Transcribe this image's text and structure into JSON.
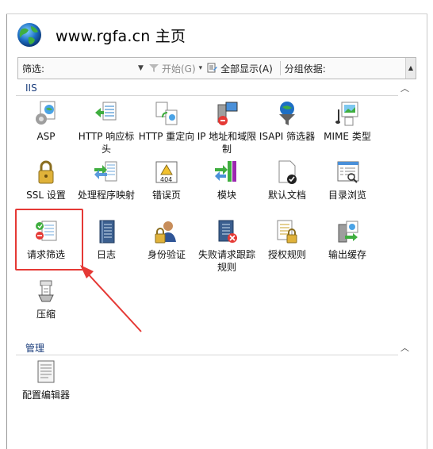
{
  "header": {
    "title": "www.rgfa.cn 主页",
    "icon": "globe-icon"
  },
  "toolbar": {
    "filter_label": "筛选:",
    "go_label": "开始(G)",
    "show_all_label": "全部显示(A)",
    "group_by_label": "分组依据:"
  },
  "sections": {
    "iis": {
      "label": "IIS"
    },
    "management": {
      "label": "管理"
    }
  },
  "features": [
    {
      "label": "ASP",
      "icon": "asp-icon"
    },
    {
      "label": "HTTP 响应标头",
      "icon": "http-response-headers-icon"
    },
    {
      "label": "HTTP 重定向",
      "icon": "http-redirect-icon"
    },
    {
      "label": "IP 地址和域限制",
      "icon": "ip-domain-restrictions-icon"
    },
    {
      "label": "ISAPI 筛选器",
      "icon": "isapi-filters-icon"
    },
    {
      "label": "MIME 类型",
      "icon": "mime-types-icon"
    },
    {
      "label": "SSL 设置",
      "icon": "ssl-settings-icon"
    },
    {
      "label": "处理程序映射",
      "icon": "handler-mappings-icon"
    },
    {
      "label": "错误页",
      "icon": "error-pages-icon"
    },
    {
      "label": "模块",
      "icon": "modules-icon"
    },
    {
      "label": "默认文档",
      "icon": "default-document-icon"
    },
    {
      "label": "目录浏览",
      "icon": "directory-browsing-icon"
    },
    {
      "label": "请求筛选",
      "icon": "request-filtering-icon"
    },
    {
      "label": "日志",
      "icon": "logging-icon"
    },
    {
      "label": "身份验证",
      "icon": "authentication-icon"
    },
    {
      "label": "失败请求跟踪规则",
      "icon": "failed-request-tracing-icon"
    },
    {
      "label": "授权规则",
      "icon": "authorization-rules-icon"
    },
    {
      "label": "输出缓存",
      "icon": "output-caching-icon"
    },
    {
      "label": "压缩",
      "icon": "compression-icon"
    }
  ],
  "management": [
    {
      "label": "配置编辑器",
      "icon": "configuration-editor-icon"
    }
  ],
  "colors": {
    "highlight": "#e53935",
    "section_label": "#1a3d7c"
  }
}
